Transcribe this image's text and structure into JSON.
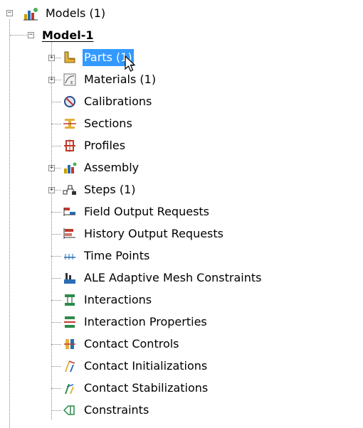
{
  "tree": {
    "root": {
      "label": "Models (1)",
      "icon": "models-icon",
      "expander": "⊟"
    },
    "model": {
      "label": "Model-1",
      "expander": "⊟"
    },
    "items": [
      {
        "label": "Parts (1)",
        "icon": "parts-icon",
        "expander": "⊞",
        "selected": true
      },
      {
        "label": "Materials (1)",
        "icon": "materials-icon",
        "expander": "⊞"
      },
      {
        "label": "Calibrations",
        "icon": "calibrations-icon"
      },
      {
        "label": "Sections",
        "icon": "sections-icon"
      },
      {
        "label": "Profiles",
        "icon": "profiles-icon"
      },
      {
        "label": "Assembly",
        "icon": "assembly-icon",
        "expander": "⊞"
      },
      {
        "label": "Steps (1)",
        "icon": "steps-icon",
        "expander": "⊞"
      },
      {
        "label": "Field Output Requests",
        "icon": "field-output-icon"
      },
      {
        "label": "History Output Requests",
        "icon": "history-output-icon"
      },
      {
        "label": "Time Points",
        "icon": "time-points-icon"
      },
      {
        "label": "ALE Adaptive Mesh Constraints",
        "icon": "ale-mesh-icon"
      },
      {
        "label": "Interactions",
        "icon": "interactions-icon"
      },
      {
        "label": "Interaction Properties",
        "icon": "interaction-properties-icon"
      },
      {
        "label": "Contact Controls",
        "icon": "contact-controls-icon"
      },
      {
        "label": "Contact Initializations",
        "icon": "contact-initializations-icon"
      },
      {
        "label": "Contact Stabilizations",
        "icon": "contact-stabilizations-icon"
      },
      {
        "label": "Constraints",
        "icon": "constraints-icon"
      }
    ]
  },
  "colors": {
    "selection": "#3399ff",
    "tree_lines": "#8a8a8a"
  },
  "cursor": {
    "icon": "mouse-pointer-icon"
  }
}
